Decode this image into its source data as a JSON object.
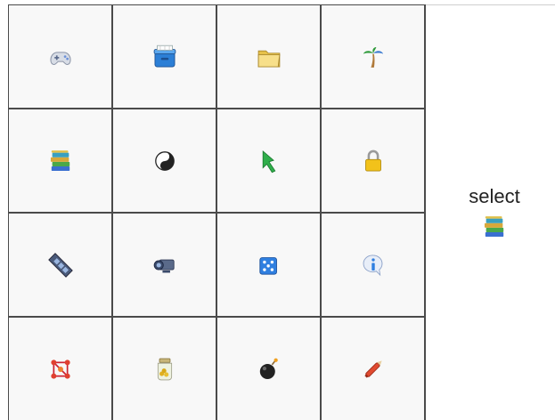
{
  "grid": {
    "cells": [
      {
        "icon": "gamepad-icon"
      },
      {
        "icon": "cooler-box-icon"
      },
      {
        "icon": "folder-icon"
      },
      {
        "icon": "palm-tree-icon"
      },
      {
        "icon": "book-stack-icon"
      },
      {
        "icon": "yin-yang-icon"
      },
      {
        "icon": "green-bookmark-icon"
      },
      {
        "icon": "padlock-icon"
      },
      {
        "icon": "film-strip-icon"
      },
      {
        "icon": "video-camera-icon"
      },
      {
        "icon": "dice-icon"
      },
      {
        "icon": "info-bubble-icon"
      },
      {
        "icon": "molecule-icon"
      },
      {
        "icon": "coin-jar-icon"
      },
      {
        "icon": "bomb-icon"
      },
      {
        "icon": "pen-icon"
      }
    ]
  },
  "side": {
    "instruction": "select",
    "target_icon": "book-stack-icon"
  }
}
